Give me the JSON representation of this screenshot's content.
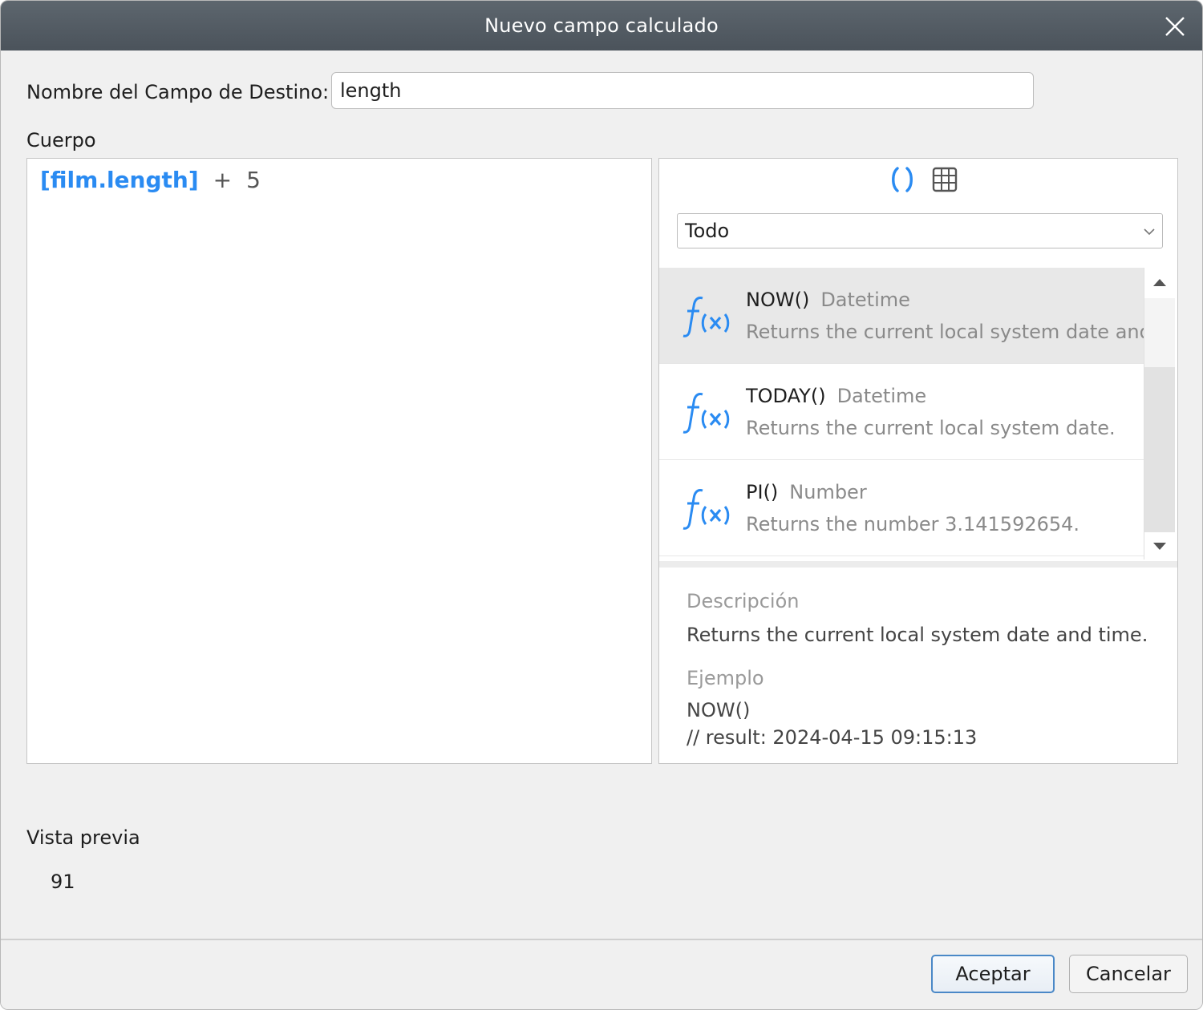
{
  "window": {
    "title": "Nuevo campo calculado"
  },
  "target_field": {
    "label": "Nombre del Campo de Destino:",
    "value": "length"
  },
  "body": {
    "label": "Cuerpo",
    "expression": {
      "field": "[film.length]",
      "operator": "+",
      "number": "5"
    }
  },
  "functions": {
    "mode_icons": [
      "function-mode-icon",
      "table-mode-icon"
    ],
    "category": {
      "selected": "Todo"
    },
    "items": [
      {
        "name": "NOW()",
        "type": "Datetime",
        "description": "Returns the current local system date and ti",
        "selected": true
      },
      {
        "name": "TODAY()",
        "type": "Datetime",
        "description": "Returns the current local system date.",
        "selected": false
      },
      {
        "name": "PI()",
        "type": "Number",
        "description": "Returns the number 3.141592654.",
        "selected": false
      }
    ],
    "details": {
      "description_label": "Descripción",
      "description": "Returns the current local system date and time.",
      "example_label": "Ejemplo",
      "example_code": "NOW()",
      "example_result": "// result: 2024-04-15 09:15:13"
    }
  },
  "preview": {
    "label": "Vista previa",
    "value": "91"
  },
  "buttons": {
    "ok": "Aceptar",
    "cancel": "Cancelar"
  },
  "colors": {
    "accent": "#2a8bf2",
    "titlebar": "#525a62",
    "selected_row": "#e8e8e8"
  }
}
